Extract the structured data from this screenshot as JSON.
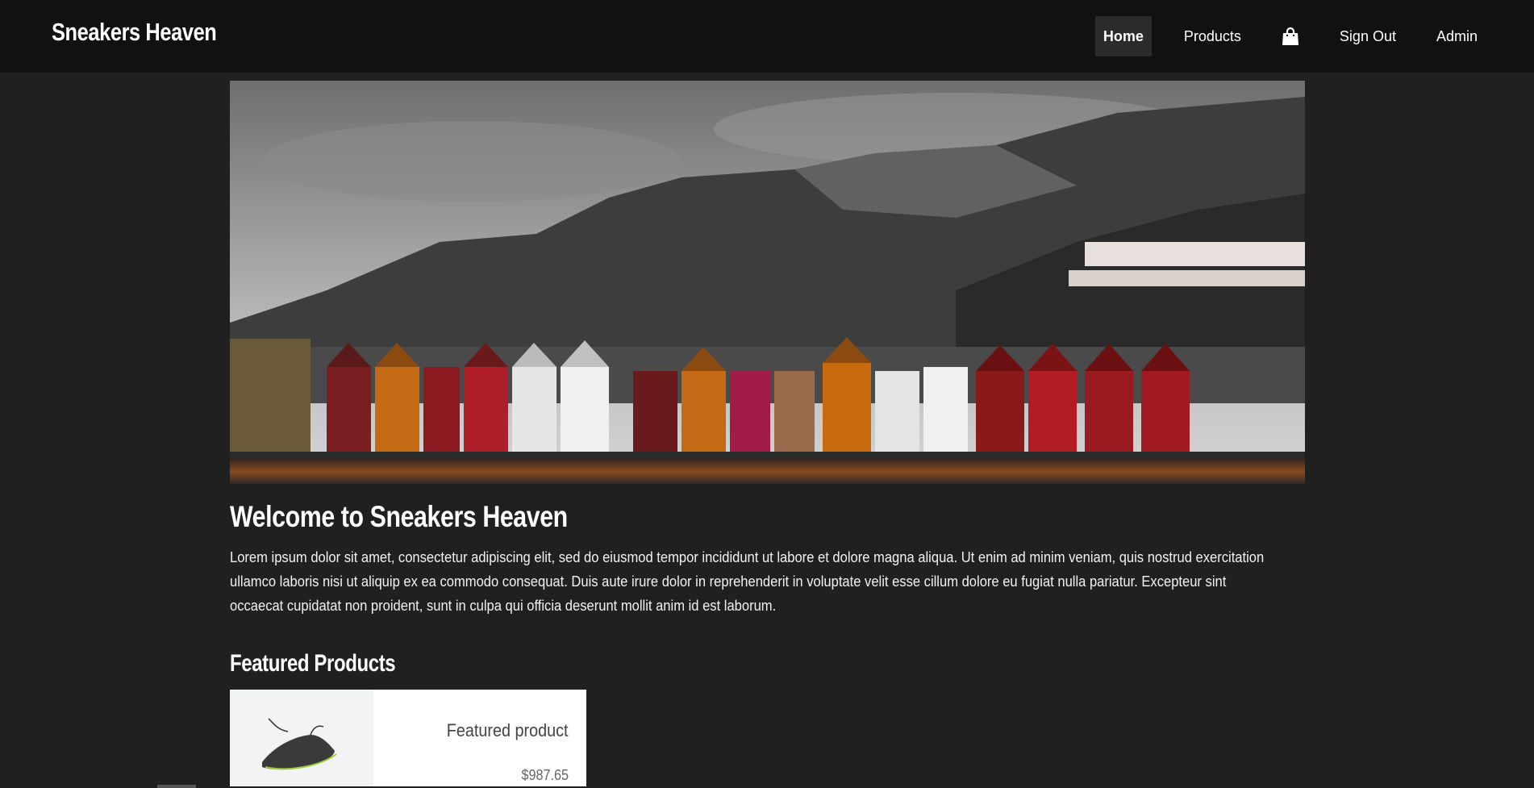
{
  "header": {
    "brand": "Sneakers Heaven",
    "nav": {
      "home": "Home",
      "products": "Products",
      "cart_icon": "shopping-bag-icon",
      "sign_out": "Sign Out",
      "admin": "Admin"
    }
  },
  "hero": {
    "image_alt": "hero-image"
  },
  "main": {
    "title": "Welcome to Sneakers Heaven",
    "body": "Lorem ipsum dolor sit amet, consectetur adipiscing elit, sed do eiusmod tempor incididunt ut labore et dolore magna aliqua. Ut enim ad minim veniam, quis nostrud exercitation ullamco laboris nisi ut aliquip ex ea commodo consequat. Duis aute irure dolor in reprehenderit in voluptate velit esse cillum dolore eu fugiat nulla pariatur. Excepteur sint occaecat cupidatat non proident, sunt in culpa qui officia deserunt mollit anim id est laborum."
  },
  "featured": {
    "title": "Featured Products",
    "products": [
      {
        "name": "Featured product",
        "price": "$987.65"
      }
    ]
  },
  "colors": {
    "navbar_bg": "#111111",
    "page_bg": "#202020",
    "active_nav_bg": "#2b2b2b",
    "card_bg": "#ffffff"
  }
}
